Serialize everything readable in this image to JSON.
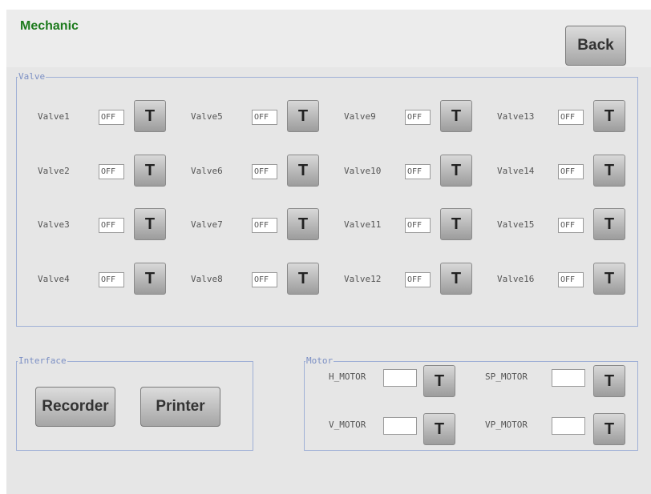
{
  "screen": {
    "title": "Mechanic",
    "back_label": "Back"
  },
  "valve": {
    "legend": "Valve",
    "items": [
      {
        "label": "Valve1",
        "state": "OFF",
        "btn": "T"
      },
      {
        "label": "Valve2",
        "state": "OFF",
        "btn": "T"
      },
      {
        "label": "Valve3",
        "state": "OFF",
        "btn": "T"
      },
      {
        "label": "Valve4",
        "state": "OFF",
        "btn": "T"
      },
      {
        "label": "Valve5",
        "state": "OFF",
        "btn": "T"
      },
      {
        "label": "Valve6",
        "state": "OFF",
        "btn": "T"
      },
      {
        "label": "Valve7",
        "state": "OFF",
        "btn": "T"
      },
      {
        "label": "Valve8",
        "state": "OFF",
        "btn": "T"
      },
      {
        "label": "Valve9",
        "state": "OFF",
        "btn": "T"
      },
      {
        "label": "Valve10",
        "state": "OFF",
        "btn": "T"
      },
      {
        "label": "Valve11",
        "state": "OFF",
        "btn": "T"
      },
      {
        "label": "Valve12",
        "state": "OFF",
        "btn": "T"
      },
      {
        "label": "Valve13",
        "state": "OFF",
        "btn": "T"
      },
      {
        "label": "Valve14",
        "state": "OFF",
        "btn": "T"
      },
      {
        "label": "Valve15",
        "state": "OFF",
        "btn": "T"
      },
      {
        "label": "Valve16",
        "state": "OFF",
        "btn": "T"
      }
    ]
  },
  "interface": {
    "legend": "Interface",
    "recorder_label": "Recorder",
    "printer_label": "Printer"
  },
  "motor": {
    "legend": "Motor",
    "items": [
      {
        "label": "H_MOTOR",
        "value": "",
        "btn": "T"
      },
      {
        "label": "V_MOTOR",
        "value": "",
        "btn": "T"
      },
      {
        "label": "SP_MOTOR",
        "value": "",
        "btn": "T"
      },
      {
        "label": "VP_MOTOR",
        "value": "",
        "btn": "T"
      }
    ]
  }
}
